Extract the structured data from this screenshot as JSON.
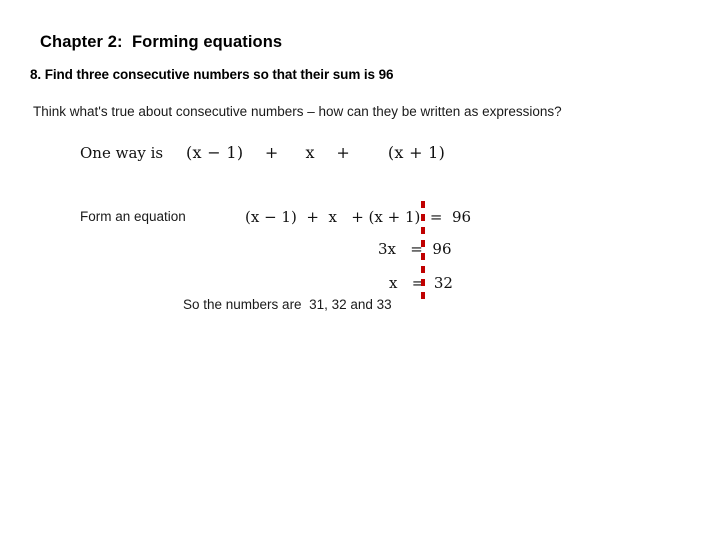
{
  "slide": {
    "title": "Chapter 2:  Forming equations",
    "question": "8. Find three consecutive numbers so that their sum is 96",
    "prompt": "Think what's true about consecutive numbers – how can they be written as expressions?",
    "one_way": {
      "label": "One way is",
      "expression": "(x − 1)    +     x    +       (x + 1)"
    },
    "form_equation": {
      "label": "Form an equation",
      "step_1": "(x − 1)  +  x   + (x + 1)  =  96",
      "step_2": "3x   =  96",
      "step_3": "x   =  32"
    },
    "conclusion": "So the numbers are  31, 32 and 33",
    "annotation": {
      "type": "red-dashed-vertical-line",
      "color": "#c00000"
    }
  }
}
